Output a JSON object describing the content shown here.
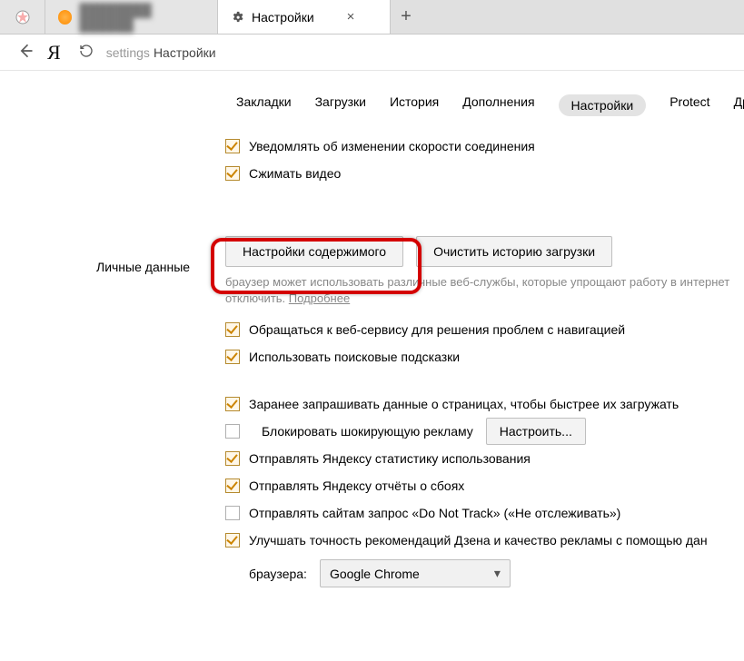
{
  "tabs": {
    "inactive_blurred": "",
    "active_label": "Настройки"
  },
  "addr": {
    "key": "settings",
    "text": "Настройки"
  },
  "nav": {
    "bookmarks": "Закладки",
    "downloads": "Загрузки",
    "history": "История",
    "addons": "Дополнения",
    "settings": "Настройки",
    "protect": "Protect",
    "other": "Другие ус"
  },
  "top_checks": {
    "conn_speed": "Уведомлять об изменении скорости соединения",
    "compress_video": "Сжимать видео"
  },
  "section_personal": "Личные данные",
  "buttons": {
    "content": "Настройки содержимого",
    "clear_history": "Очистить историю загрузки",
    "configure": "Настроить..."
  },
  "hint": {
    "line": "браузер может использовать различные веб-службы, которые упрощают работу в интернет",
    "line2": "отключить.",
    "more": "Подробнее"
  },
  "checks": {
    "nav_service": "Обращаться к веб-сервису для решения проблем с навигацией",
    "suggest": "Использовать поисковые подсказки",
    "prefetch": "Заранее запрашивать данные о страницах, чтобы быстрее их загружать",
    "shock_ads": "Блокировать шокирующую рекламу",
    "usage_stats": "Отправлять Яндексу статистику использования",
    "crash_reports": "Отправлять Яндексу отчёты о сбоях",
    "dnt": "Отправлять сайтам запрос «Do Not Track» («Не отслеживать»)",
    "zen_quality": "Улучшать точность рекомендаций Дзена и качество рекламы с помощью дан"
  },
  "default_browser": {
    "label": "браузера:",
    "value": "Google Chrome"
  }
}
